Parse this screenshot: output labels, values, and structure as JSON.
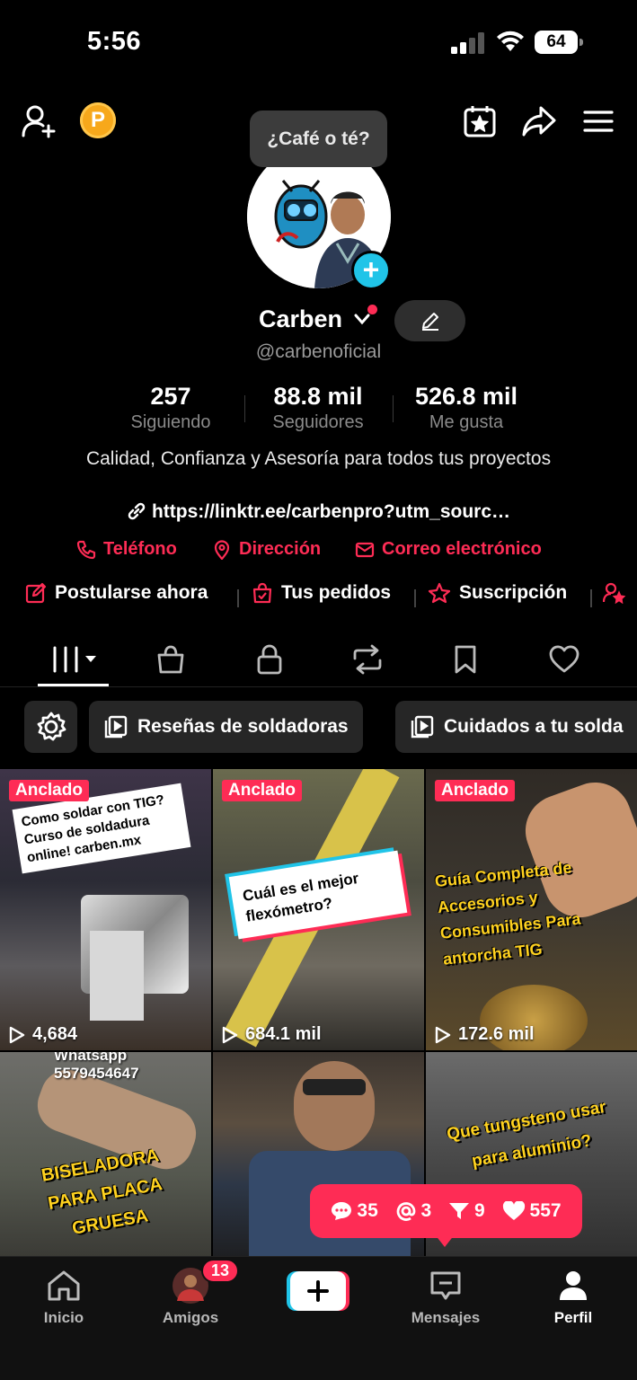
{
  "status": {
    "time": "5:56",
    "battery": "64"
  },
  "header": {
    "coin_label": "P"
  },
  "bubble": {
    "text": "¿Café o té?"
  },
  "profile": {
    "name": "Carben",
    "handle": "@carbenoficial",
    "stats": [
      {
        "value": "257",
        "label": "Siguiendo"
      },
      {
        "value": "88.8 mil",
        "label": "Seguidores"
      },
      {
        "value": "526.8 mil",
        "label": "Me gusta"
      }
    ],
    "bio": "Calidad, Confianza y Asesoría para todos tus proyectos",
    "link": "https://linktr.ee/carbenpro?utm_sourc…"
  },
  "contacts": [
    {
      "label": "Teléfono",
      "icon": "phone-icon"
    },
    {
      "label": "Dirección",
      "icon": "location-pin-icon"
    },
    {
      "label": "Correo electrónico",
      "icon": "mail-icon"
    }
  ],
  "actions": [
    {
      "label": "Postularse ahora",
      "icon": "apply-edit-icon"
    },
    {
      "label": "Tus pedidos",
      "icon": "orders-bag-icon"
    },
    {
      "label": "Suscripción",
      "icon": "subscription-star-icon"
    }
  ],
  "tabs": [
    "videos-grid",
    "shop-bag",
    "private-lock",
    "reposts",
    "saved-bookmark",
    "liked-heart"
  ],
  "playlists": [
    {
      "label": "Reseñas de soldadoras"
    },
    {
      "label": "Cuidados a tu solda"
    }
  ],
  "videos": [
    {
      "pinned": "Anclado",
      "views": "4,684",
      "caption": "Como soldar con TIG? Curso de soldadura online! carben.mx"
    },
    {
      "pinned": "Anclado",
      "views": "684.1 mil",
      "caption": "Cuál es el mejor flexómetro?"
    },
    {
      "pinned": "Anclado",
      "views": "172.6 mil",
      "caption": "Guía Completa de Accesorios y Consumibles Para antorcha TIG"
    },
    {
      "caption_top": "Whatsapp",
      "caption_phone": "5579454647",
      "caption": "BISELADORA PARA PLACA GRUESA"
    },
    {
      "caption": ""
    },
    {
      "caption": "Que tungsteno usar para aluminio?"
    }
  ],
  "notification": {
    "comments": "35",
    "mentions": "3",
    "followers": "9",
    "likes": "557"
  },
  "nav": {
    "home": "Inicio",
    "friends": "Amigos",
    "friends_badge": "13",
    "messages": "Mensajes",
    "profile": "Perfil"
  },
  "colors": {
    "accent": "#fe2c55",
    "cyan": "#20c4e8",
    "coin": "#f7a81b"
  }
}
